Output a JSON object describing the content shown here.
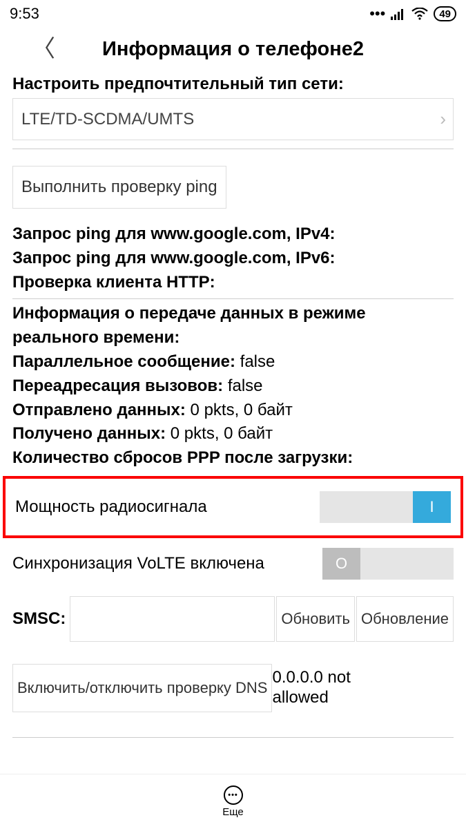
{
  "statusbar": {
    "time": "9:53",
    "battery": "49"
  },
  "header": {
    "title": "Информация о телефоне2"
  },
  "network": {
    "section_label": "Настроить предпочтительный тип сети:",
    "dropdown_value": "LTE/TD-SCDMA/UMTS"
  },
  "ping": {
    "button_label": "Выполнить проверку ping",
    "ipv4_label": "Запрос ping для www.google.com, IPv4:",
    "ipv6_label": "Запрос ping для www.google.com, IPv6:",
    "http_label": "Проверка клиента HTTP:"
  },
  "realtime": {
    "header": "Информация о передаче данных в режиме реального времени:",
    "parallel_label": "Параллельное сообщение:",
    "parallel_value": "false",
    "forwarding_label": "Переадресация вызовов:",
    "forwarding_value": "false",
    "sent_label": "Отправлено данных:",
    "sent_value": "0 pkts, 0 байт",
    "recv_label": "Получено данных:",
    "recv_value": "0 pkts, 0 байт",
    "ppp_label": "Количество сбросов PPP после загрузки:"
  },
  "toggles": {
    "radio_label": "Мощность радиосигнала",
    "radio_on_char": "I",
    "volte_label": "Синхронизация VoLTE включена",
    "volte_off_char": "O"
  },
  "smsc": {
    "label": "SMSC:",
    "update_btn": "Обновить",
    "refresh_btn": "Обновление"
  },
  "dns": {
    "toggle_btn": "Включить/отключить проверку DNS",
    "value": "0.0.0.0 not allowed"
  },
  "footer": {
    "more_label": "Еще"
  }
}
